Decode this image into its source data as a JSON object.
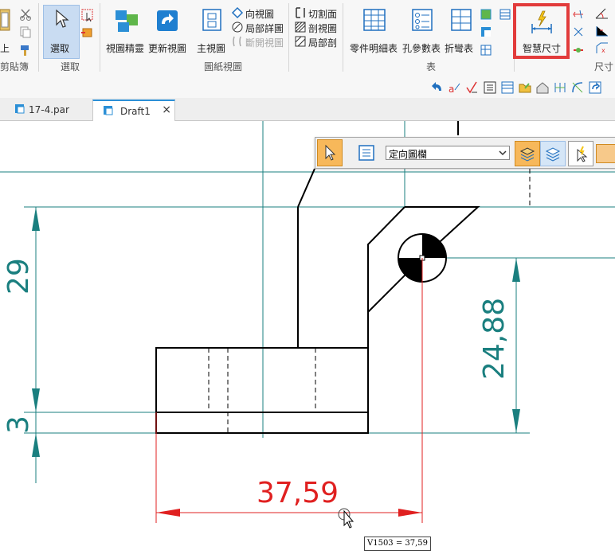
{
  "ribbon": {
    "left_cut_label": "上",
    "clipboard_group": "剪貼簿",
    "select": {
      "label": "選取",
      "group": "選取"
    },
    "drawing_views": {
      "view_wizard": "視圖精靈",
      "update_views": "更新視圖",
      "principal_view": "主視圖",
      "auxiliary_view": "向視圖",
      "detail_view": "局部詳圖",
      "broken_view": "斷開視圖",
      "group": "圖紙視圖"
    },
    "section": {
      "cutting_plane": "切割面",
      "section_view": "剖視圖",
      "broken_out": "局部剖"
    },
    "tables": {
      "parts_list": "零件明細表",
      "hole_table": "孔參數表",
      "bend_table": "折彎表",
      "group": "表"
    },
    "smart_dimension": "智慧尺寸",
    "dimension_group": "尺寸"
  },
  "tabs": [
    {
      "label": "17-4.par",
      "active": false
    },
    {
      "label": "Draft1",
      "active": true
    }
  ],
  "tab_close": "×",
  "command_bar": {
    "selected_option": "定向圖欄"
  },
  "dimensions": {
    "d29": "29",
    "d3": "3",
    "d2488": "24,88",
    "d3759": "37,59"
  },
  "tooltip": "V1503 = 37,59",
  "colors": {
    "dimension_teal": "#1a7f7f",
    "active_dimension": "#e02020",
    "highlight_box": "#e23b3b",
    "geometry": "#000000"
  }
}
